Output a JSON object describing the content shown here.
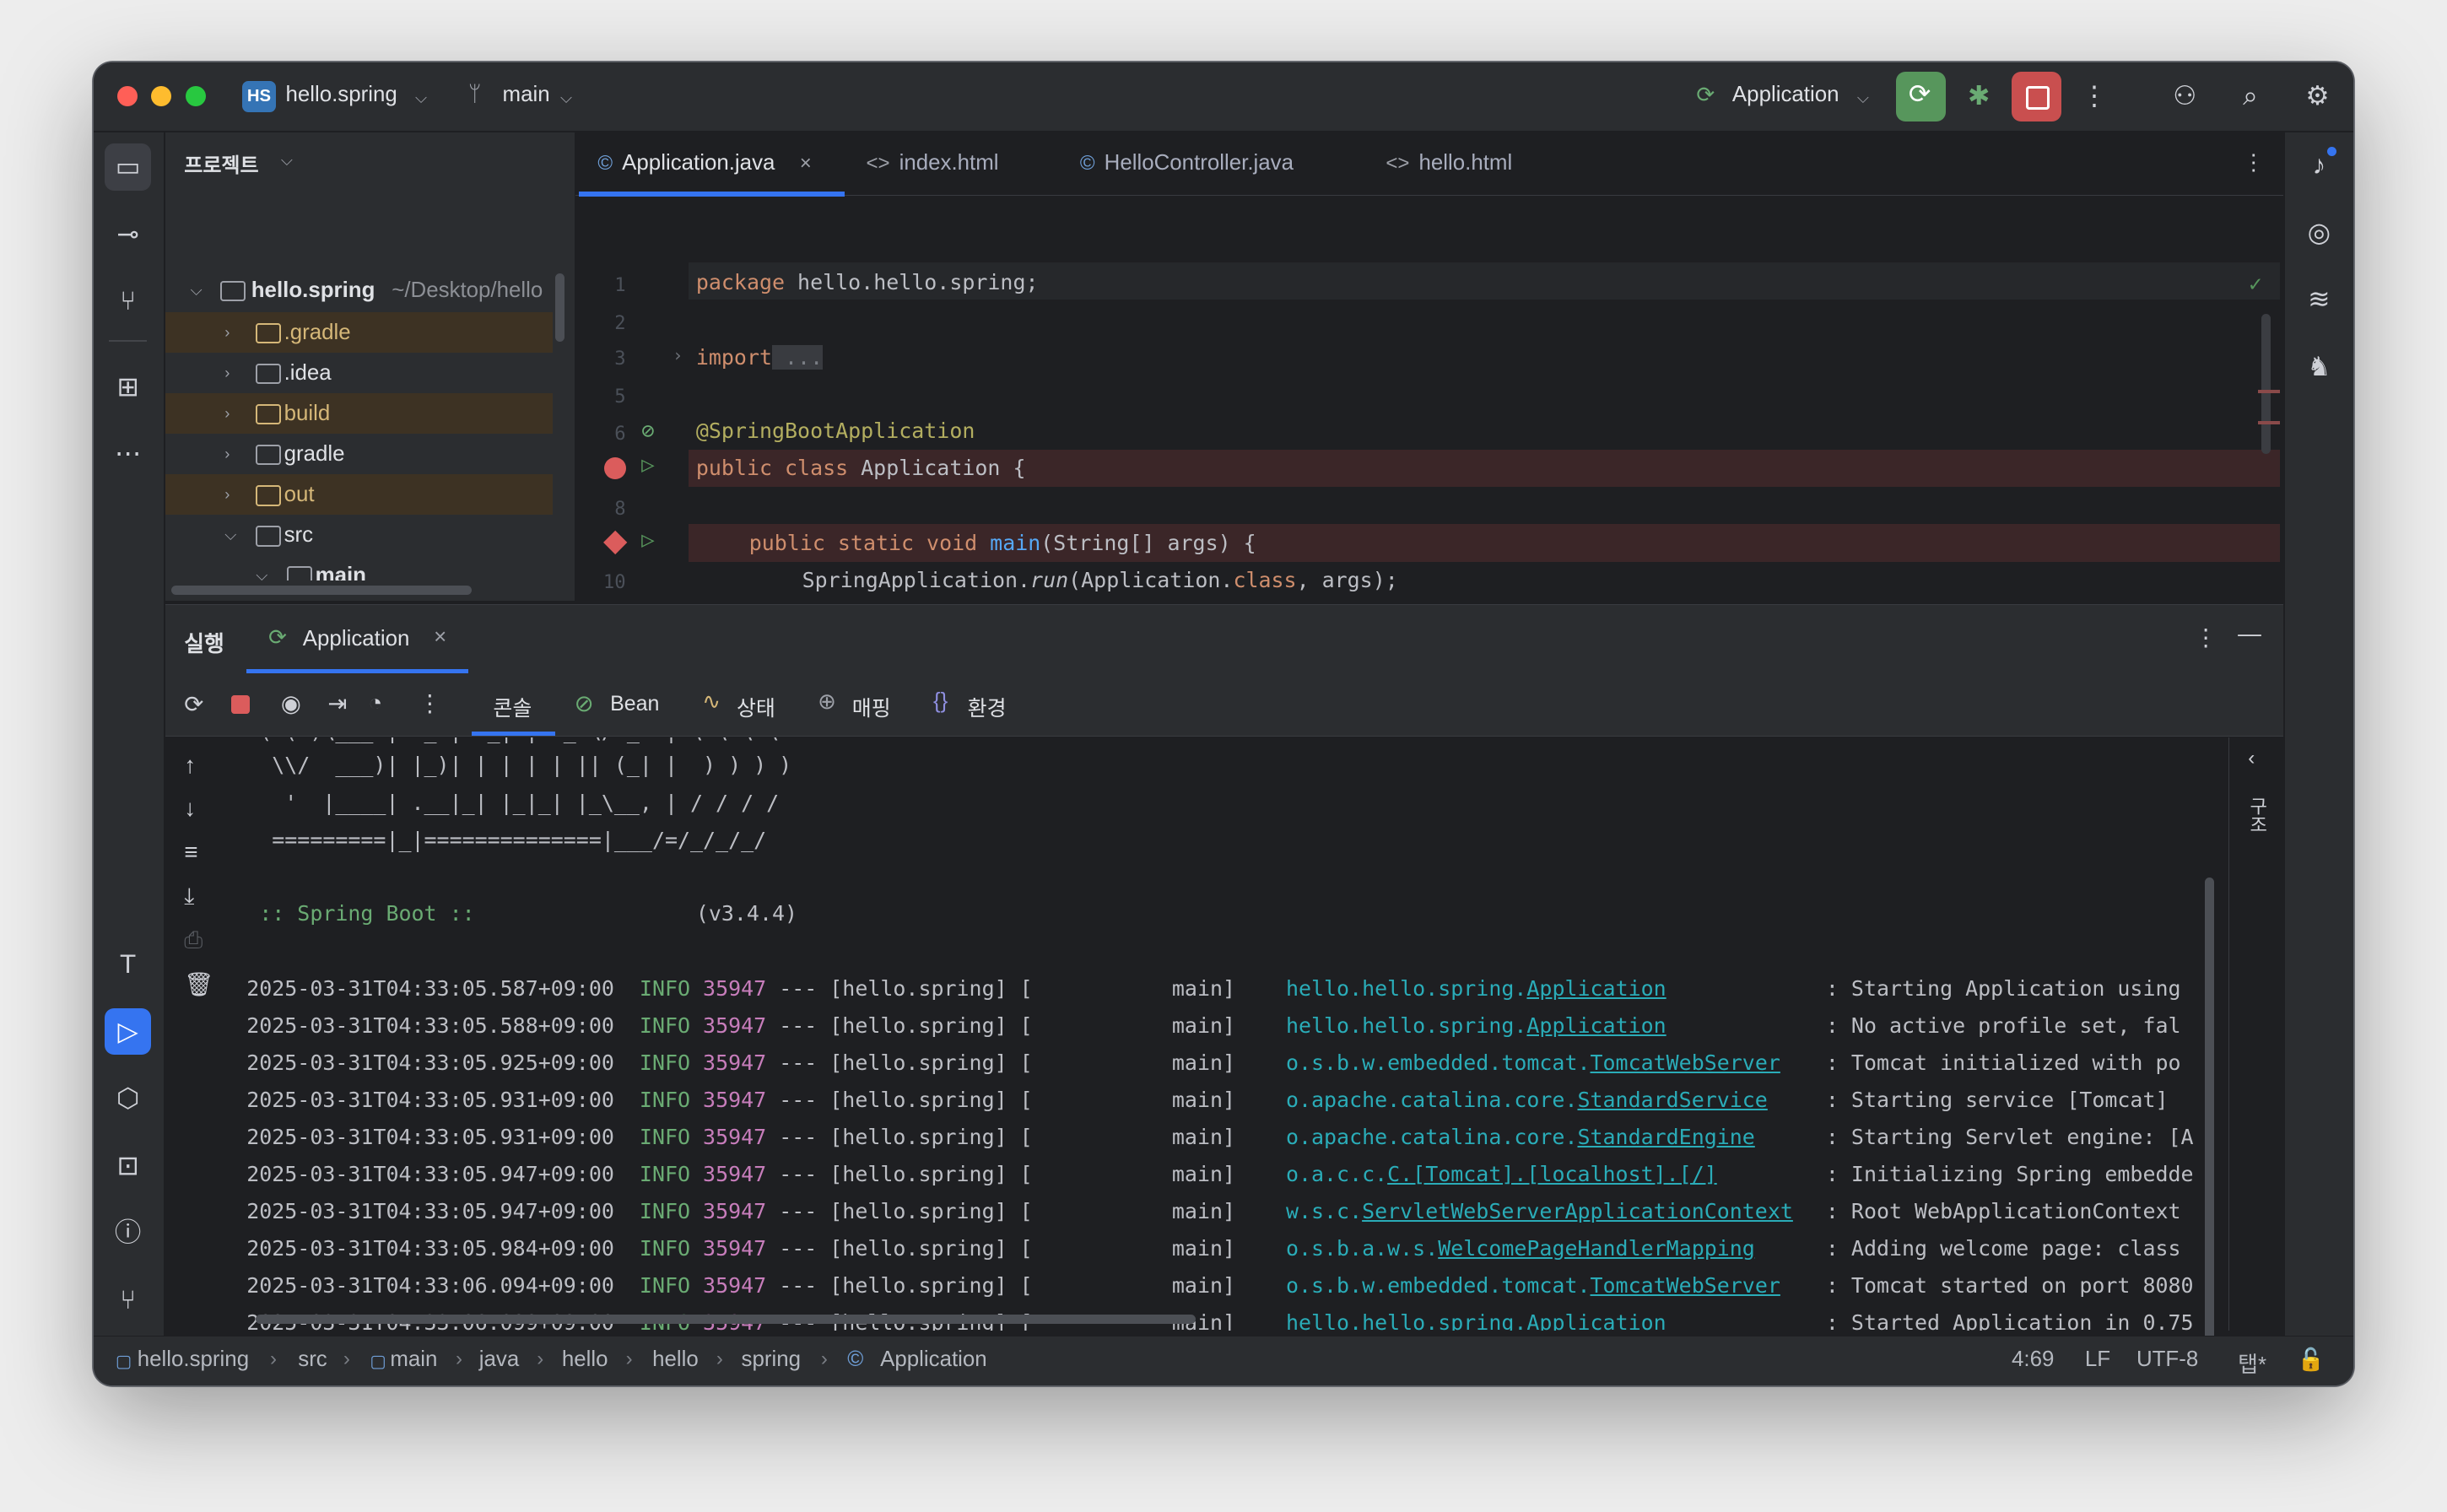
{
  "titlebar": {
    "project_badge": "HS",
    "project_name": "hello.spring",
    "branch": "main",
    "run_config": "Application"
  },
  "project_panel": {
    "title": "프로젝트",
    "root_name": "hello.spring",
    "root_path": "~/Desktop/hello",
    "items": [
      {
        "label": ".gradle",
        "excluded": true
      },
      {
        "label": ".idea",
        "excluded": false
      },
      {
        "label": "build",
        "excluded": true
      },
      {
        "label": "gradle",
        "excluded": false
      },
      {
        "label": "out",
        "excluded": true
      },
      {
        "label": "src",
        "excluded": false
      },
      {
        "label": "main",
        "excluded": false
      }
    ]
  },
  "editor_tabs": [
    "Application.java",
    "index.html",
    "HelloController.java",
    "hello.html"
  ],
  "code": {
    "line_numbers": [
      "1",
      "2",
      "3",
      "5",
      "6",
      "8",
      "10"
    ],
    "l1_kw": "package",
    "l1_rest": " hello.hello.spring;",
    "l3_kw": "import",
    "l3_rest": " ...",
    "l6_ann": "@SpringBootApplication",
    "l7_kw": "public class",
    "l7_rest": " Application {",
    "l9_kw": "public static void",
    "l9_fn": " main",
    "l9_rest": "(String[] args) {",
    "l10_a": "SpringApplication.",
    "l10_run": "run",
    "l10_b": "(Application.",
    "l10_kw": "class",
    "l10_c": ", args);"
  },
  "run_panel": {
    "title": "실행",
    "tab": "Application",
    "subtabs": [
      "콘솔",
      "Bean",
      "상태",
      "매핑",
      "환경"
    ],
    "side_label": "구조"
  },
  "console": {
    "banner": [
      "  \\\\/  ___)| |_)| | | | | || (_| |  ) ) ) )",
      "   '  |____| .__|_| |_|_| |_\\__, | / / / /",
      "  =========|_|==============|___/=/_/_/_/"
    ],
    "boot_label": " :: Spring Boot :: ",
    "boot_version": "(v3.4.4)",
    "logs": [
      {
        "ts": "2025-03-31T04:33:05.587+09:00",
        "pid": "35947",
        "logger_pre": "hello.hello.spring.",
        "logger_cls": "Application",
        "msg": ": Starting Application using"
      },
      {
        "ts": "2025-03-31T04:33:05.588+09:00",
        "pid": "35947",
        "logger_pre": "hello.hello.spring.",
        "logger_cls": "Application",
        "msg": ": No active profile set, fal"
      },
      {
        "ts": "2025-03-31T04:33:05.925+09:00",
        "pid": "35947",
        "logger_pre": "o.s.b.w.embedded.tomcat.",
        "logger_cls": "TomcatWebServer",
        "msg": ": Tomcat initialized with po"
      },
      {
        "ts": "2025-03-31T04:33:05.931+09:00",
        "pid": "35947",
        "logger_pre": "o.apache.catalina.core.",
        "logger_cls": "StandardService",
        "msg": ": Starting service [Tomcat]"
      },
      {
        "ts": "2025-03-31T04:33:05.931+09:00",
        "pid": "35947",
        "logger_pre": "o.apache.catalina.core.",
        "logger_cls": "StandardEngine",
        "msg": ": Starting Servlet engine: [A"
      },
      {
        "ts": "2025-03-31T04:33:05.947+09:00",
        "pid": "35947",
        "logger_pre": "o.a.c.c.",
        "logger_cls": "C.[Tomcat].[localhost].[/]",
        "msg": ": Initializing Spring embedde"
      },
      {
        "ts": "2025-03-31T04:33:05.947+09:00",
        "pid": "35947",
        "logger_pre": "w.s.c.",
        "logger_cls": "ServletWebServerApplicationContext",
        "msg": ": Root WebApplicationContext"
      },
      {
        "ts": "2025-03-31T04:33:05.984+09:00",
        "pid": "35947",
        "logger_pre": "o.s.b.a.w.s.",
        "logger_cls": "WelcomePageHandlerMapping",
        "msg": ": Adding welcome page: class"
      },
      {
        "ts": "2025-03-31T04:33:06.094+09:00",
        "pid": "35947",
        "logger_pre": "o.s.b.w.embedded.tomcat.",
        "logger_cls": "TomcatWebServer",
        "msg": ": Tomcat started on port 8080"
      },
      {
        "ts": "2025-03-31T04:33:06.099+09:00",
        "pid": "35947",
        "logger_pre": "hello.hello.spring.",
        "logger_cls": "Application",
        "msg": ": Started Application in 0.75"
      }
    ],
    "level": "INFO",
    "mid": " --- [hello.spring] [           main] ",
    "prompt": "$"
  },
  "statusbar": {
    "crumbs": [
      "hello.spring",
      "src",
      "main",
      "java",
      "hello",
      "hello",
      "spring",
      "Application"
    ],
    "position": "4:69",
    "line_sep": "LF",
    "encoding": "UTF-8",
    "indent": "탭*"
  }
}
